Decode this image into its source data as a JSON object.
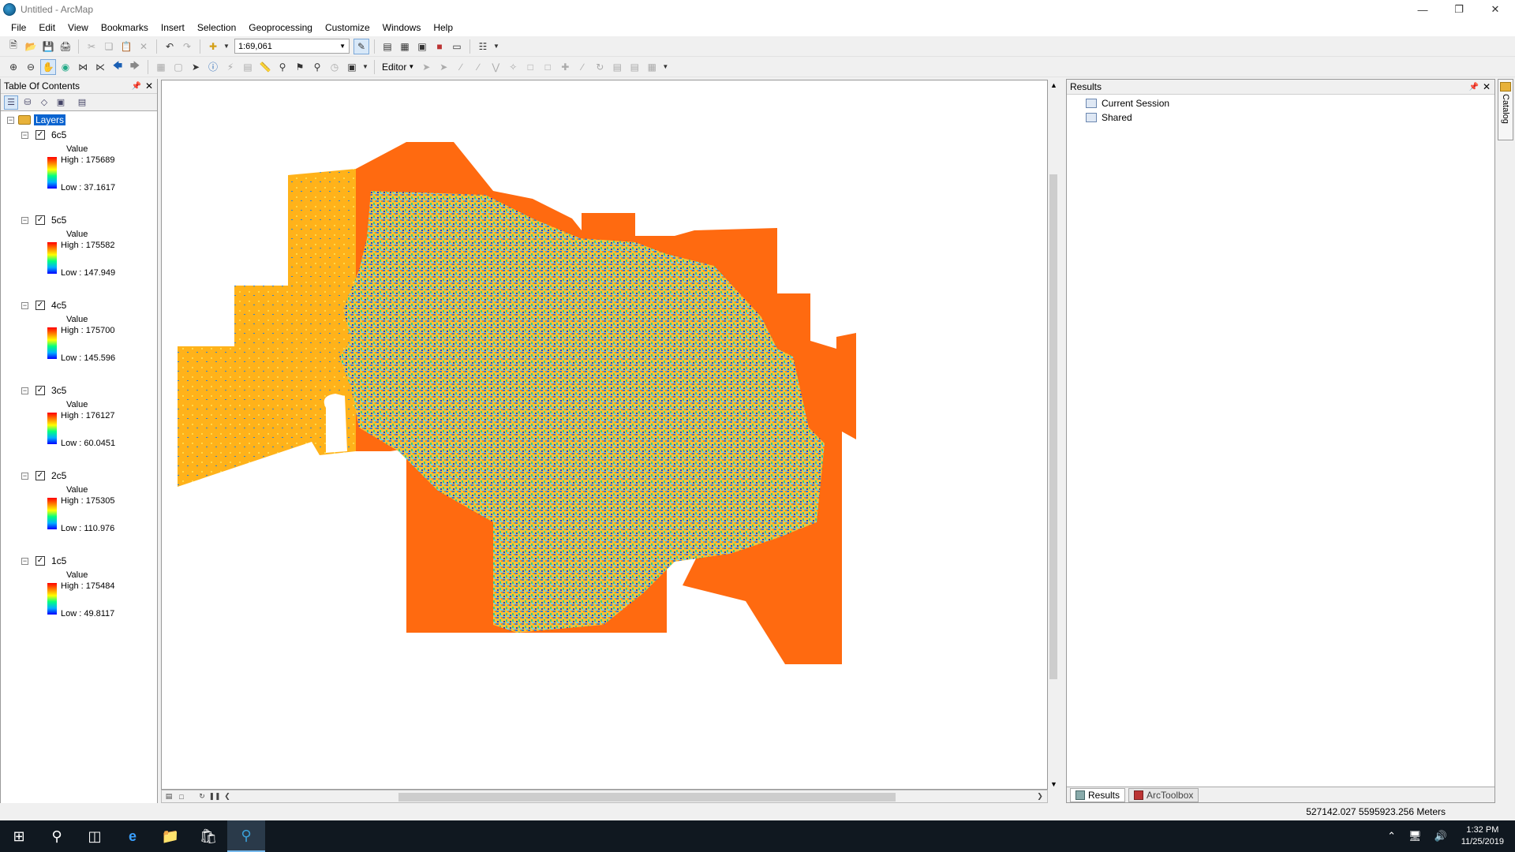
{
  "window": {
    "title": "Untitled - ArcMap"
  },
  "menu": [
    "File",
    "Edit",
    "View",
    "Bookmarks",
    "Insert",
    "Selection",
    "Geoprocessing",
    "Customize",
    "Windows",
    "Help"
  ],
  "toolbar": {
    "scale": "1:69,061",
    "editor_label": "Editor"
  },
  "toc": {
    "title": "Table Of Contents",
    "root_label": "Layers",
    "layers": [
      {
        "name": "6c5",
        "checked": true,
        "field": "Value",
        "high": "High : 175689",
        "low": "Low : 37.1617"
      },
      {
        "name": "5c5",
        "checked": true,
        "field": "Value",
        "high": "High : 175582",
        "low": "Low : 147.949"
      },
      {
        "name": "4c5",
        "checked": true,
        "field": "Value",
        "high": "High : 175700",
        "low": "Low : 145.596"
      },
      {
        "name": "3c5",
        "checked": true,
        "field": "Value",
        "high": "High : 176127",
        "low": "Low : 60.0451"
      },
      {
        "name": "2c5",
        "checked": true,
        "field": "Value",
        "high": "High : 175305",
        "low": "Low : 110.976"
      },
      {
        "name": "1c5",
        "checked": true,
        "field": "Value",
        "high": "High : 175484",
        "low": "Low : 49.8117"
      }
    ]
  },
  "results": {
    "title": "Results",
    "items": [
      "Current Session",
      "Shared"
    ],
    "tabs": [
      "Results",
      "ArcToolbox"
    ]
  },
  "catalog_tab": "Catalog",
  "status": {
    "coordinates": "527142.027  5595923.256 Meters"
  },
  "taskbar": {
    "time": "1:32 PM",
    "date": "11/25/2019"
  },
  "colors": {
    "selection": "#0a64d0",
    "map_orange": "#ff6a10",
    "map_yellow": "#ffb000",
    "taskbar": "#101820"
  }
}
